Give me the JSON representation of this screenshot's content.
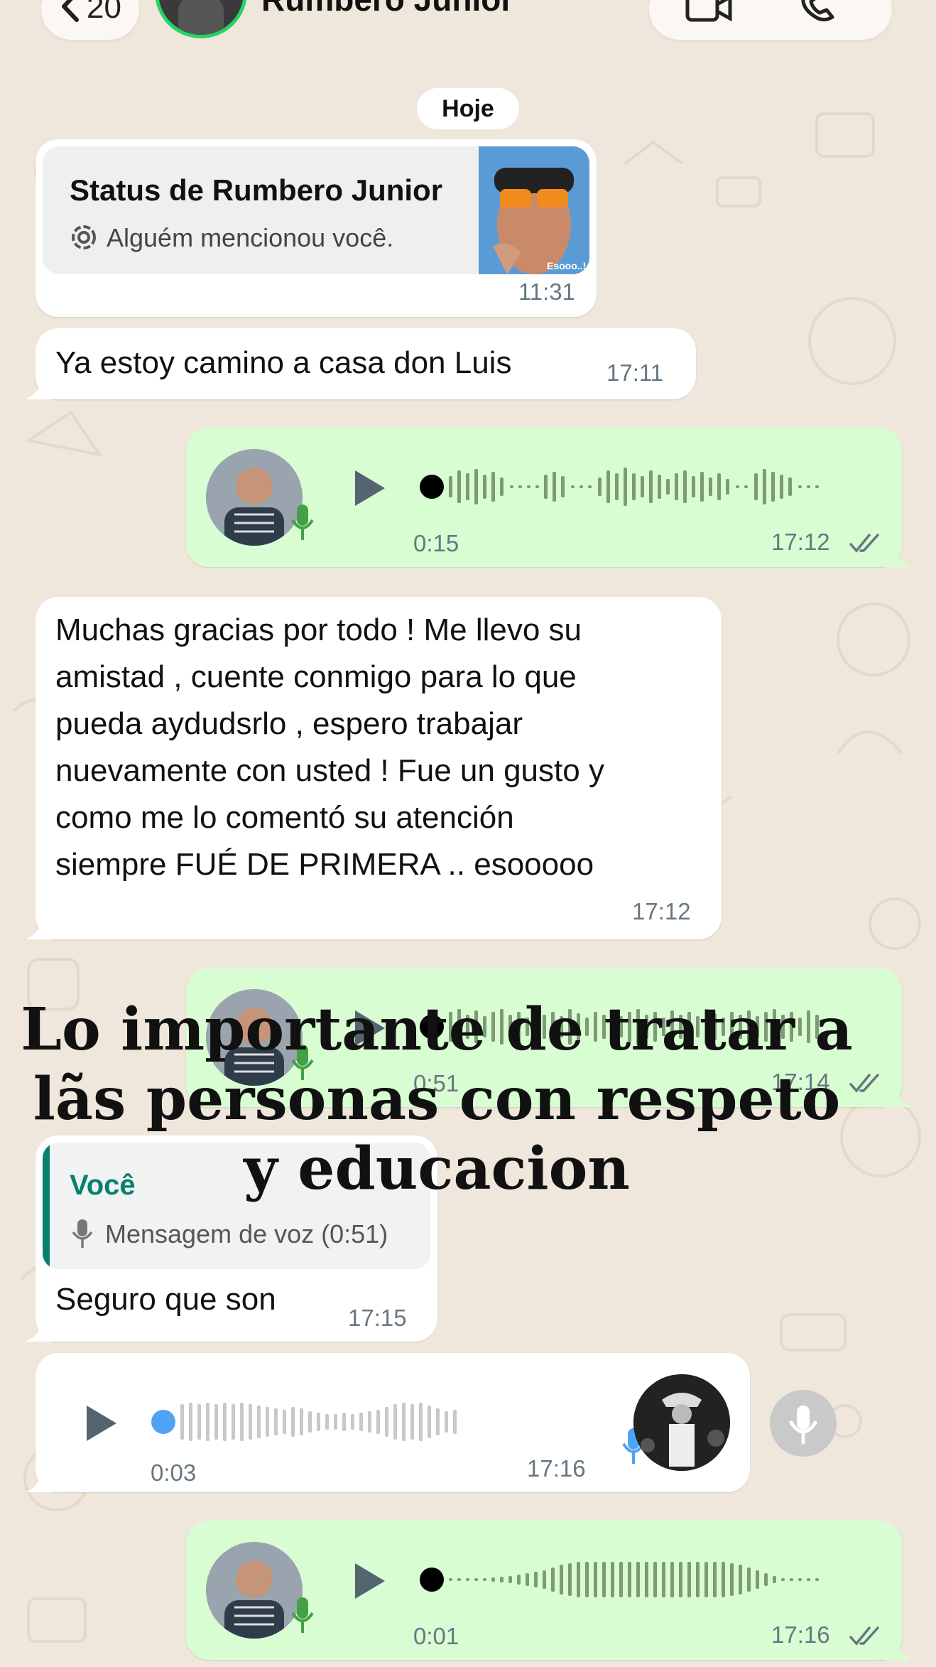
{
  "header": {
    "back_count": "20",
    "contact_name": "Rumbero Junior"
  },
  "date_chip": "Hoje",
  "messages": {
    "status_reply": {
      "title": "Status de Rumbero Junior",
      "subtitle": "Alguém mencionou você.",
      "thumb_caption": "Esooo..!",
      "time": "11:31"
    },
    "m1": {
      "text": "Ya estoy camino a casa don Luis",
      "time": "17:11"
    },
    "voice1": {
      "duration": "0:15",
      "time": "17:12",
      "progress": 0
    },
    "m2": {
      "lines": [
        "Muchas gracias por todo ! Me llevo su",
        "amistad , cuente conmigo para lo que",
        "pueda aydudsrlo , espero trabajar",
        "nuevamente con usted ! Fue un gusto y",
        "como me lo comentó su atención",
        "siempre FUÉ DE PRIMERA .. esooooo"
      ],
      "time": "17:12"
    },
    "voice2": {
      "duration": "0:51",
      "time": "17:14",
      "progress": 0
    },
    "reply": {
      "quoted_author": "Você",
      "quoted_text": "Mensagem de voz (0:51)",
      "text": "Seguro que son",
      "time": "17:15"
    },
    "voice3": {
      "duration": "0:03",
      "time": "17:16",
      "progress": 0
    },
    "voice4": {
      "duration": "0:01",
      "time": "17:16",
      "progress": 0
    }
  },
  "overlay_caption": {
    "lines": [
      "Lo importante de tratar a",
      "lãs personas con respeto",
      "y educacion"
    ]
  },
  "icons": [
    "chevron-left-icon",
    "video-call-icon",
    "phone-icon",
    "status-mention-icon",
    "play-icon",
    "mic-icon",
    "double-check-icon"
  ],
  "colors": {
    "background": "#efe7dc",
    "incoming_bubble": "#ffffff",
    "outgoing_bubble": "#d9fdd3",
    "accent_green": "#25d366",
    "reply_accent": "#06816e",
    "read_tick": "#667781",
    "unplayed_dot": "#4fa3f7"
  }
}
